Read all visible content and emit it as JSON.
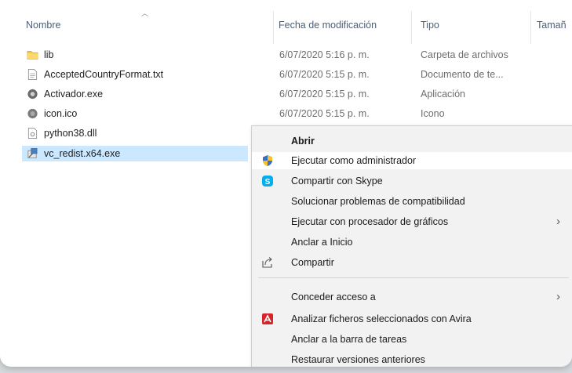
{
  "columns": {
    "name": "Nombre",
    "modified": "Fecha de modificación",
    "type": "Tipo",
    "size": "Tamañ"
  },
  "files": [
    {
      "name": "lib",
      "date": "6/07/2020 5:16 p. m.",
      "type": "Carpeta de archivos",
      "icon": "folder-icon"
    },
    {
      "name": "AcceptedCountryFormat.txt",
      "date": "6/07/2020 5:15 p. m.",
      "type": "Documento de te...",
      "icon": "text-file-icon"
    },
    {
      "name": "Activador.exe",
      "date": "6/07/2020 5:15 p. m.",
      "type": "Aplicación",
      "icon": "app-icon"
    },
    {
      "name": "icon.ico",
      "date": "6/07/2020 5:15 p. m.",
      "type": "Icono",
      "icon": "ico-file-icon"
    },
    {
      "name": "python38.dll",
      "date": "",
      "type": "",
      "icon": "dll-file-icon"
    },
    {
      "name": "vc_redist.x64.exe",
      "date": "",
      "type": "",
      "icon": "installer-icon",
      "selected": true
    }
  ],
  "context_menu": {
    "items": [
      {
        "label": "Abrir",
        "bold": true
      },
      {
        "label": "Ejecutar como administrador",
        "icon": "uac-shield-icon"
      },
      {
        "label": "Compartir con Skype",
        "icon": "skype-icon"
      },
      {
        "label": "Solucionar problemas de compatibilidad"
      },
      {
        "label": "Ejecutar con procesador de gráficos",
        "submenu": true
      },
      {
        "label": "Anclar a Inicio"
      },
      {
        "label": "Compartir",
        "icon": "share-icon"
      },
      {
        "label": "Conceder acceso a",
        "submenu": true
      },
      {
        "label": "Analizar ficheros seleccionados con Avira",
        "icon": "avira-icon"
      },
      {
        "label": "Anclar a la barra de tareas"
      },
      {
        "label": "Restaurar versiones anteriores"
      }
    ],
    "submenu_arrow": "›"
  },
  "colors": {
    "selection": "#cce8ff",
    "menu_bg": "#f2f2f2",
    "header_text": "#4c607a",
    "folder": "#f5c84b",
    "skype": "#00aff0",
    "avira": "#d8232a"
  }
}
